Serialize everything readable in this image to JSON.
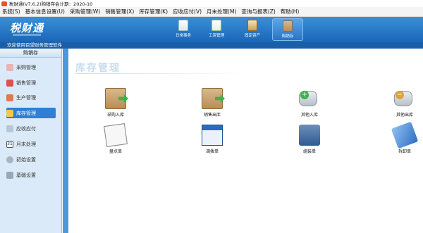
{
  "window": {
    "title": "税财通(V7.6.2)购销存会计期：2020-10"
  },
  "menu": [
    "系统(S)",
    "基本信息设置(U)",
    "采购管理(W)",
    "销售管理(X)",
    "库存管理(K)",
    "应收应付(V)",
    "月末处理(M)",
    "查询与报表(Z)",
    "帮助(H)"
  ],
  "brand": "税财通",
  "toolbar": [
    {
      "label": "日常事务",
      "icon": "document-icon"
    },
    {
      "label": "工资管理",
      "icon": "payroll-icon"
    },
    {
      "label": "固定资产",
      "icon": "fixed-assets-icon"
    },
    {
      "label": "购销存",
      "icon": "inventory-box-icon"
    }
  ],
  "welcome": "欢迎使用百望财务管理软件",
  "sidebar": {
    "header": "购销存",
    "items": [
      {
        "label": "采购管理",
        "icon": "purchase-icon"
      },
      {
        "label": "销售管理",
        "icon": "sales-icon"
      },
      {
        "label": "生产管理",
        "icon": "production-icon"
      },
      {
        "label": "库存管理",
        "icon": "inventory-icon"
      },
      {
        "label": "应收应付",
        "icon": "receivable-icon"
      },
      {
        "label": "月末处理",
        "icon": "calendar-icon"
      },
      {
        "label": "初始设置",
        "icon": "settings-icon"
      },
      {
        "label": "基础设置",
        "icon": "base-settings-icon"
      }
    ]
  },
  "main": {
    "title": "库存管理",
    "operations": [
      {
        "label": "采购入库",
        "icon": "purchase-inbound-icon"
      },
      {
        "label": "销售出库",
        "icon": "sales-outbound-icon"
      },
      {
        "label": "其他入库",
        "icon": "other-inbound-icon"
      },
      {
        "label": "其他出库",
        "icon": "other-outbound-icon"
      },
      {
        "label": "盘点单",
        "icon": "stocktake-icon"
      },
      {
        "label": "调拨单",
        "icon": "transfer-icon"
      },
      {
        "label": "组装单",
        "icon": "assembly-icon"
      },
      {
        "label": "拆卸单",
        "icon": "disassembly-icon"
      }
    ]
  },
  "colors": {
    "toolbar": "#1a66b8",
    "sidebar": "#dbeaf8",
    "active": "#2f7fd4",
    "title": "#c9dcef"
  }
}
